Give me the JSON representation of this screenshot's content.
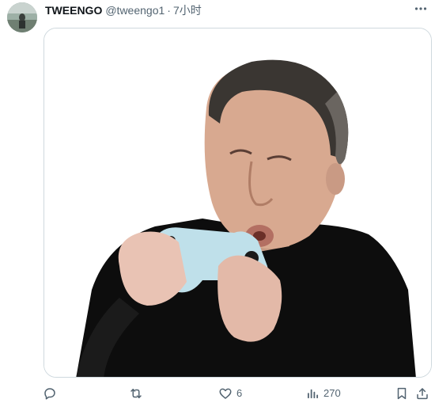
{
  "tweet": {
    "author_name": "TWEENGO",
    "author_handle": "@tweengo1",
    "separator": "·",
    "timestamp": "7小时",
    "avatar_icon": "user-avatar-icon",
    "more_icon": "more-horizontal-icon",
    "media": {
      "type": "photo",
      "alt": "Man holding a white game controller with puffed cheeks"
    },
    "actions": {
      "reply": {
        "icon": "reply-icon",
        "count": ""
      },
      "retweet": {
        "icon": "retweet-icon",
        "count": ""
      },
      "like": {
        "icon": "heart-icon",
        "count": "6"
      },
      "views": {
        "icon": "views-chart-icon",
        "count": "270"
      },
      "bookmark": {
        "icon": "bookmark-icon"
      },
      "share": {
        "icon": "share-icon"
      }
    }
  },
  "colors": {
    "text_primary": "#0f1419",
    "text_secondary": "#536471",
    "border": "#cfd9de"
  }
}
